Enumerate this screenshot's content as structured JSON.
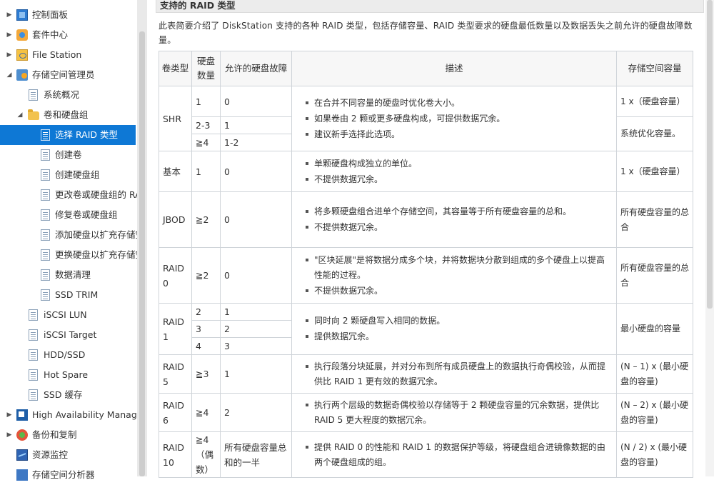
{
  "sidebar": {
    "items": [
      {
        "label": "控制面板",
        "icon": "control-panel-icon"
      },
      {
        "label": "套件中心",
        "icon": "package-center-icon"
      },
      {
        "label": "File Station",
        "icon": "file-station-icon"
      },
      {
        "label": "存储空间管理员",
        "icon": "storage-manager-icon"
      },
      {
        "label": "系统概况",
        "icon": "page-icon"
      },
      {
        "label": "卷和硬盘组",
        "icon": "folder-icon"
      },
      {
        "label": "选择 RAID 类型",
        "icon": "page-icon"
      },
      {
        "label": "创建卷",
        "icon": "page-icon"
      },
      {
        "label": "创建硬盘组",
        "icon": "page-icon"
      },
      {
        "label": "更改卷或硬盘组的 RA",
        "icon": "page-icon"
      },
      {
        "label": "修复卷或硬盘组",
        "icon": "page-icon"
      },
      {
        "label": "添加硬盘以扩充存储空",
        "icon": "page-icon"
      },
      {
        "label": "更换硬盘以扩充存储空",
        "icon": "page-icon"
      },
      {
        "label": "数据清理",
        "icon": "page-icon"
      },
      {
        "label": "SSD TRIM",
        "icon": "page-icon"
      },
      {
        "label": "iSCSI LUN",
        "icon": "page-icon"
      },
      {
        "label": "iSCSI Target",
        "icon": "page-icon"
      },
      {
        "label": "HDD/SSD",
        "icon": "page-icon"
      },
      {
        "label": "Hot Spare",
        "icon": "page-icon"
      },
      {
        "label": "SSD 缓存",
        "icon": "page-icon"
      },
      {
        "label": "High Availability Manage",
        "icon": "high-availability-icon"
      },
      {
        "label": "备份和复制",
        "icon": "backup-icon"
      },
      {
        "label": "资源监控",
        "icon": "resource-monitor-icon"
      },
      {
        "label": "存储空间分析器",
        "icon": "storage-analyzer-icon"
      }
    ],
    "selected": "选择 RAID 类型"
  },
  "content": {
    "section_title": "支持的 RAID 类型",
    "intro": "此表简要介绍了 DiskStation 支持的各种 RAID 类型，包括存储容量、RAID 类型要求的硬盘最低数量以及数据丢失之前允许的硬盘故障数量。",
    "table": {
      "headers": {
        "vol_type": "卷类型",
        "disk_count": "硬盘数量",
        "fault": "允许的硬盘故障",
        "desc": "描述",
        "capacity": "存储空间容量"
      },
      "rows": {
        "shr": {
          "type": "SHR",
          "sub": [
            {
              "disks": "1",
              "fault": "0"
            },
            {
              "disks": "2-3",
              "fault": "1"
            },
            {
              "disks": "≧4",
              "fault": "1-2"
            }
          ],
          "desc": [
            "在合并不同容量的硬盘时优化卷大小。",
            "如果卷由 2 颗或更多硬盘构成，可提供数据冗余。",
            "建议新手选择此选项。"
          ],
          "cap1": "1 x（硬盘容量）",
          "cap2": "系统优化容量。"
        },
        "basic": {
          "type": "基本",
          "disks": "1",
          "fault": "0",
          "desc": [
            "单颗硬盘构成独立的单位。",
            "不提供数据冗余。"
          ],
          "cap": "1 x（硬盘容量）"
        },
        "jbod": {
          "type": "JBOD",
          "disks": "≧2",
          "fault": "0",
          "desc": [
            "将多颗硬盘组合进单个存储空间，其容量等于所有硬盘容量的总和。",
            "不提供数据冗余。"
          ],
          "cap": "所有硬盘容量的总合"
        },
        "raid0": {
          "type": "RAID 0",
          "disks": "≧2",
          "fault": "0",
          "desc": [
            "\"区块延展\"是将数据分成多个块，并将数据块分散到组成的多个硬盘上以提高性能的过程。",
            "不提供数据冗余。"
          ],
          "cap": "所有硬盘容量的总合"
        },
        "raid1": {
          "type": "RAID 1",
          "sub": [
            {
              "disks": "2",
              "fault": "1"
            },
            {
              "disks": "3",
              "fault": "2"
            },
            {
              "disks": "4",
              "fault": "3"
            }
          ],
          "desc": [
            "同时向 2 颗硬盘写入相同的数据。",
            "提供数据冗余。"
          ],
          "cap": "最小硬盘的容量"
        },
        "raid5": {
          "type": "RAID 5",
          "disks": "≧3",
          "fault": "1",
          "desc": [
            "执行段落分块延展，并对分布到所有成员硬盘上的数据执行奇偶校验，从而提供比 RAID 1 更有效的数据冗余。"
          ],
          "cap": "(N – 1) x (最小硬盘的容量)"
        },
        "raid6": {
          "type": "RAID 6",
          "disks": "≧4",
          "fault": "2",
          "desc": [
            "执行两个层级的数据奇偶校验以存储等于 2 颗硬盘容量的冗余数据，提供比 RAID 5 更大程度的数据冗余。"
          ],
          "cap": "(N – 2) x (最小硬盘的容量)"
        },
        "raid10": {
          "type": "RAID 10",
          "disks": "≧4（偶数）",
          "fault": "所有硬盘容量总和的一半",
          "desc": [
            "提供 RAID 0 的性能和 RAID 1 的数据保护等级，将硬盘组合进镜像数据的由两个硬盘组成的组。"
          ],
          "cap": "(N / 2) x (最小硬盘的容量)"
        }
      }
    }
  }
}
